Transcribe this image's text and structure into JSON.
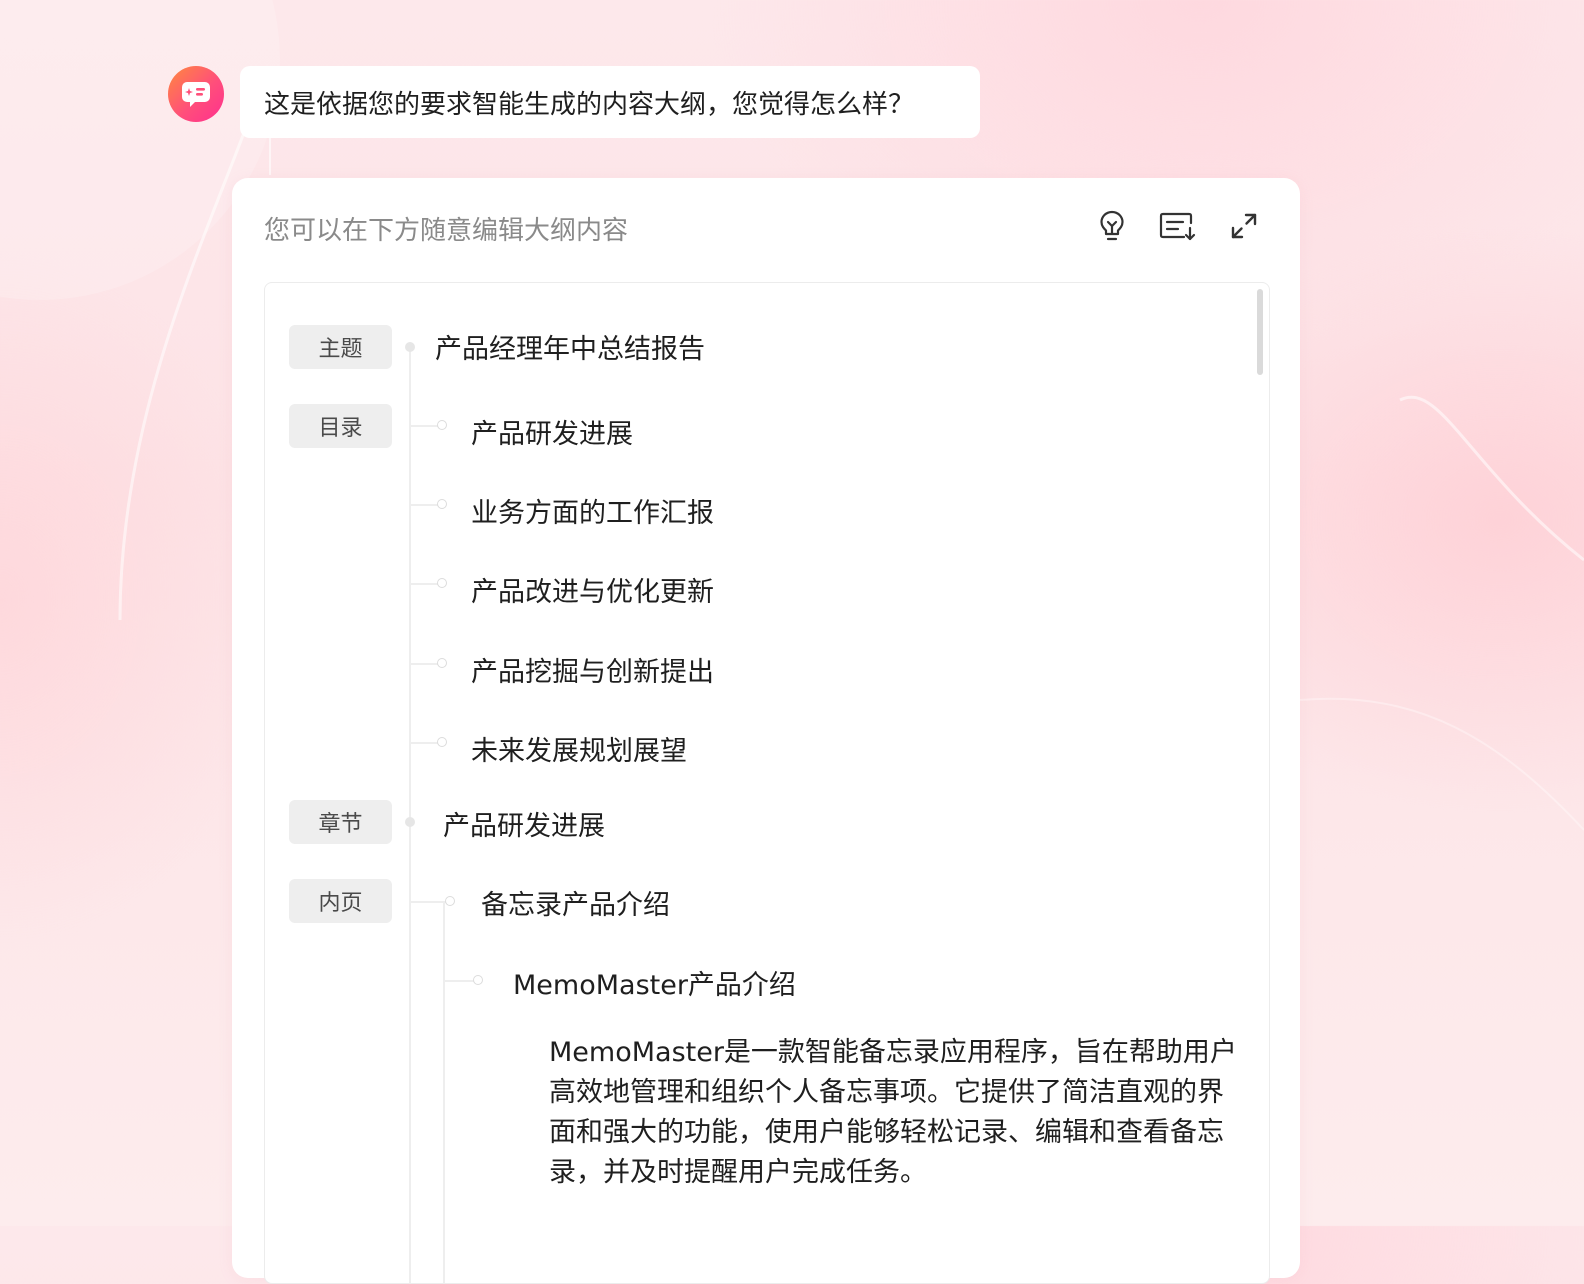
{
  "chat": {
    "message": "这是依据您的要求智能生成的内容大纲，您觉得怎么样？"
  },
  "card": {
    "hint": "您可以在下方随意编辑大纲内容",
    "toolbar": {
      "ideas_icon": "lightbulb-icon",
      "insert_icon": "text-insert-icon",
      "expand_icon": "expand-icon"
    }
  },
  "outline": {
    "tags": {
      "theme": "主题",
      "toc": "目录",
      "chapter": "章节",
      "inner_page": "内页"
    },
    "theme_title": "产品经理年中总结报告",
    "toc_items": [
      "产品研发进展",
      "业务方面的工作汇报",
      "产品改进与优化更新",
      "产品挖掘与创新提出",
      "未来发展规划展望"
    ],
    "chapter_title": "产品研发进展",
    "page_title": "备忘录产品介绍",
    "subsection_title": "MemoMaster产品介绍",
    "paragraph": "MemoMaster是一款智能备忘录应用程序，旨在帮助用户高效地管理和组织个人备忘事项。它提供了简洁直观的界面和强大的功能，使用户能够轻松记录、编辑和查看备忘录，并及时提醒用户完成任务。"
  },
  "colors": {
    "avatar_gradient_start": "#ff8a3d",
    "avatar_gradient_end": "#ff2f8f",
    "tag_bg": "#eeeeee",
    "hint_text": "#8a8a8a"
  }
}
